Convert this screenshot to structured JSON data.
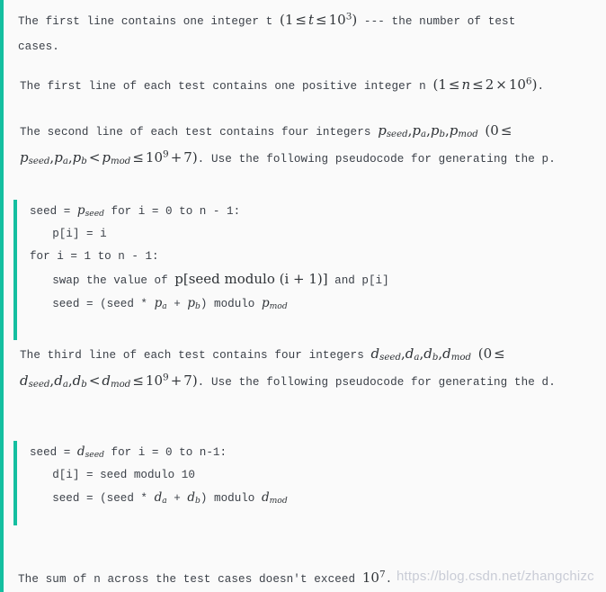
{
  "theme": {
    "background": "#fafafa",
    "accent_rail": "#14bfa0",
    "text": "#3b4048",
    "math_text": "#2f3337",
    "watermark": "#c9ccd6"
  },
  "paragraphs": {
    "p1": {
      "lead": "The first line contains one integer t",
      "math": "(1 ≤ t ≤ 10³)",
      "math_parts": {
        "open": "(",
        "lower": "1",
        "rel1": "≤",
        "var": "t",
        "rel2": "≤",
        "base": "10",
        "exp": "3",
        "close": ")"
      },
      "tail": "--- the number of test",
      "line2": "cases."
    },
    "p2": {
      "lead": "The first line of each test contains one positive integer n",
      "math_parts": {
        "open": "(",
        "lower": "1",
        "rel1": "≤",
        "var": "n",
        "rel2": "≤",
        "coef": "2",
        "times": "×",
        "base": "10",
        "exp": "6",
        "close": ")"
      },
      "tail": "."
    },
    "p3": {
      "lead": "The second line of each test contains four integers",
      "vars_inline": "p_seed, p_a, p_b, p_mod",
      "vars": [
        {
          "base": "p",
          "sub": "seed"
        },
        {
          "base": "p",
          "sub": "a"
        },
        {
          "base": "p",
          "sub": "b"
        },
        {
          "base": "p",
          "sub": "mod"
        }
      ],
      "range_open": "(0",
      "range_rel1": "≤",
      "range_vars": [
        {
          "base": "p",
          "sub": "seed"
        },
        {
          "base": "p",
          "sub": "a"
        },
        {
          "base": "p",
          "sub": "b"
        }
      ],
      "range_rel2": "<",
      "range_upper_var": {
        "base": "p",
        "sub": "mod"
      },
      "range_rel3": "≤",
      "range_base": "10",
      "range_exp": "9",
      "range_plus": "+",
      "range_add": "7",
      "range_close": ")",
      "tail": ". Use the following pseudocode for generating the p."
    },
    "p4": {
      "lead": "The third line of each test contains four integers",
      "vars_inline": "d_seed, d_a, d_b, d_mod",
      "vars": [
        {
          "base": "d",
          "sub": "seed"
        },
        {
          "base": "d",
          "sub": "a"
        },
        {
          "base": "d",
          "sub": "b"
        },
        {
          "base": "d",
          "sub": "mod"
        }
      ],
      "range_open": "(0",
      "range_rel1": "≤",
      "range_vars": [
        {
          "base": "d",
          "sub": "seed"
        },
        {
          "base": "d",
          "sub": "a"
        },
        {
          "base": "d",
          "sub": "b"
        }
      ],
      "range_rel2": "<",
      "range_upper_var": {
        "base": "d",
        "sub": "mod"
      },
      "range_rel3": "≤",
      "range_base": "10",
      "range_exp": "9",
      "range_plus": "+",
      "range_add": "7",
      "range_close": ")",
      "tail": ". Use the following pseudocode for generating the d."
    },
    "p5": {
      "lead": "The sum of n across the test cases doesn't exceed",
      "math_base": "10",
      "math_exp": "7",
      "tail": "."
    }
  },
  "code_block_p": {
    "line1_a": "seed = ",
    "line1_var": {
      "base": "p",
      "sub": "seed"
    },
    "line1_b": " for i = 0 to n - 1:",
    "line2": "p[i] = i",
    "line3": "for i = 1 to n - 1:",
    "line4_a": "swap the value of ",
    "line4_math": "p[seed modulo (i + 1)]",
    "line4_b": " and p[i]",
    "line5_a": "seed = (seed * ",
    "line5_var_a": {
      "base": "p",
      "sub": "a"
    },
    "line5_mid": " + ",
    "line5_var_b": {
      "base": "p",
      "sub": "b"
    },
    "line5_b": ") modulo ",
    "line5_var_mod": {
      "base": "p",
      "sub": "mod"
    }
  },
  "code_block_d": {
    "line1_a": "seed = ",
    "line1_var": {
      "base": "d",
      "sub": "seed"
    },
    "line1_b": " for i = 0 to n-1:",
    "line2": "d[i] = seed modulo 10",
    "line3_a": "seed = (seed * ",
    "line3_var_a": {
      "base": "d",
      "sub": "a"
    },
    "line3_mid": " + ",
    "line3_var_b": {
      "base": "d",
      "sub": "b"
    },
    "line3_b": ") modulo ",
    "line3_var_mod": {
      "base": "d",
      "sub": "mod"
    }
  },
  "watermark": {
    "text": "https://blog.csdn.net/zhangchizc"
  }
}
